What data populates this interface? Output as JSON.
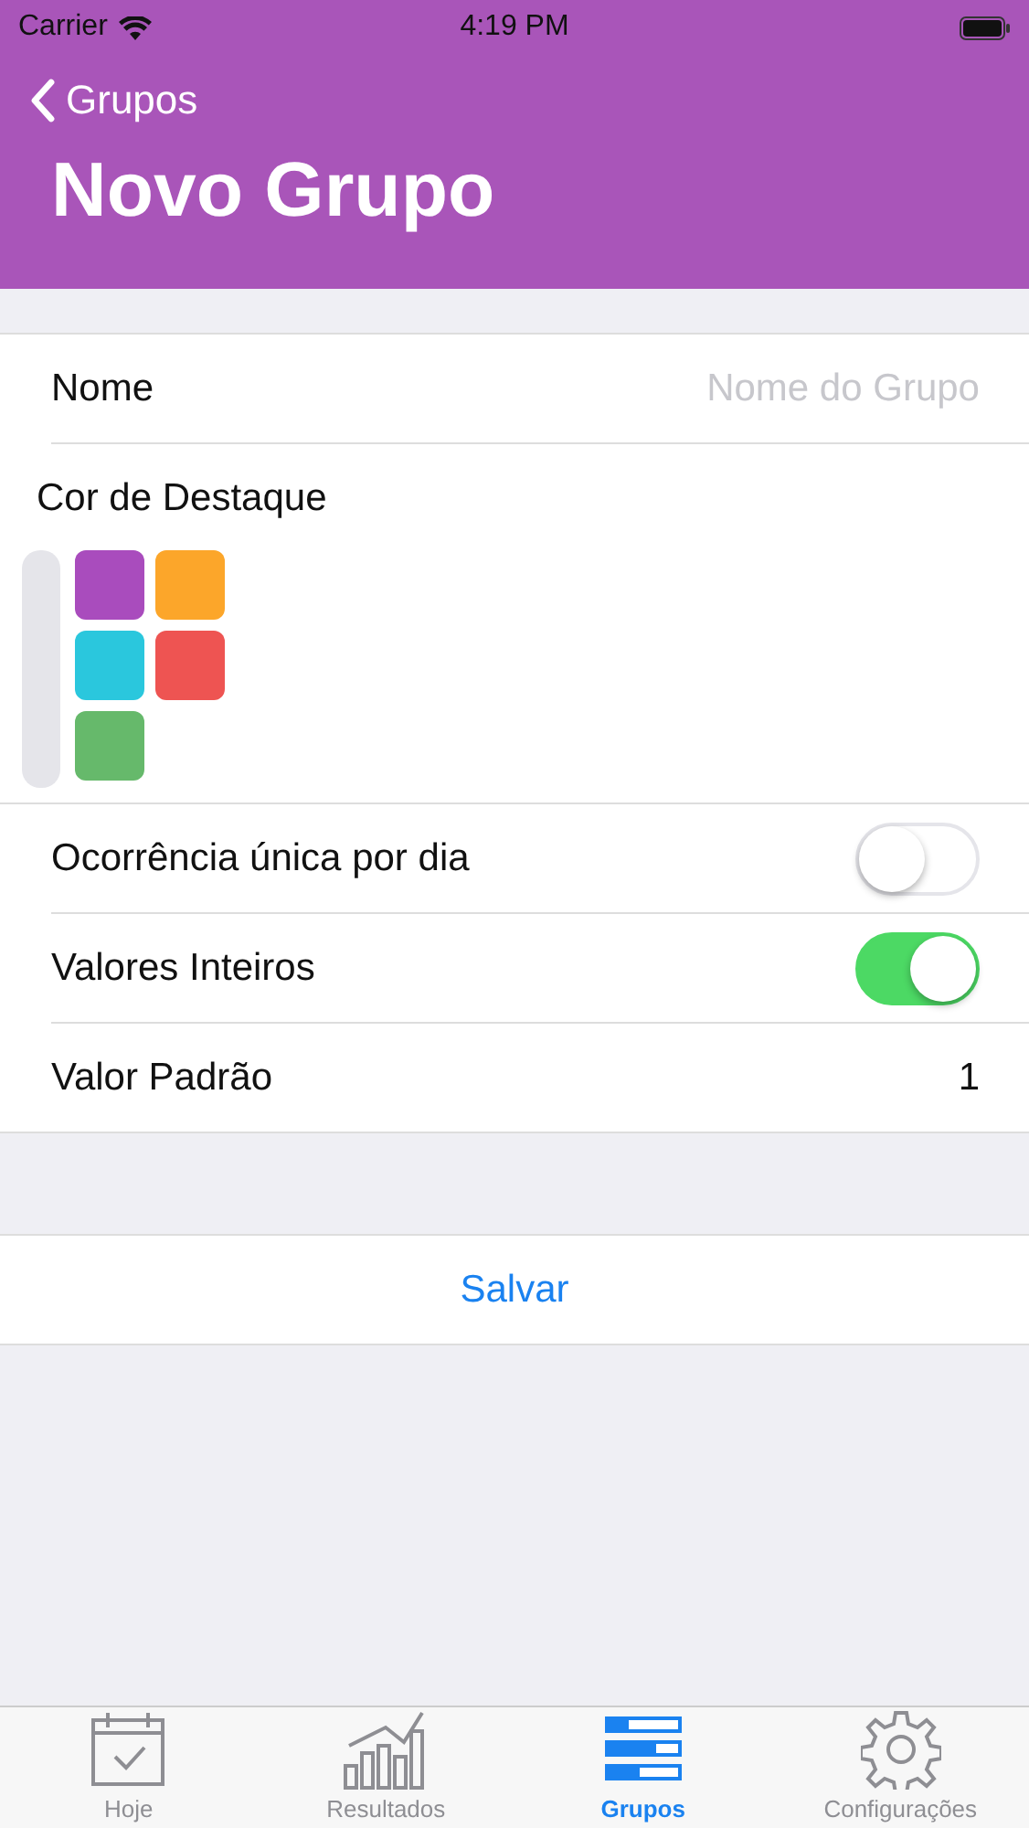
{
  "status_bar": {
    "carrier": "Carrier",
    "time": "4:19 PM"
  },
  "nav": {
    "back": "Grupos",
    "title": "Novo Grupo"
  },
  "form": {
    "name_label": "Nome",
    "name_placeholder": "Nome do Grupo",
    "color_label": "Cor de Destaque",
    "colors": [
      {
        "color": "#a94cbd"
      },
      {
        "color": "#fca62a"
      },
      {
        "color": "#2ac7dd"
      },
      {
        "color": "#ee5452"
      },
      {
        "color": "#66b96b"
      }
    ],
    "toggles": [
      {
        "label": "Ocorrência única por dia",
        "on": false
      },
      {
        "label": "Valores Inteiros",
        "on": true
      }
    ],
    "default_label": "Valor Padrão",
    "default_value": "1"
  },
  "save_button": "Salvar",
  "tabs": [
    {
      "label": "Hoje",
      "selected": false
    },
    {
      "label": "Resultados",
      "selected": false
    },
    {
      "label": "Grupos",
      "selected": true
    },
    {
      "label": "Configurações",
      "selected": false
    }
  ]
}
